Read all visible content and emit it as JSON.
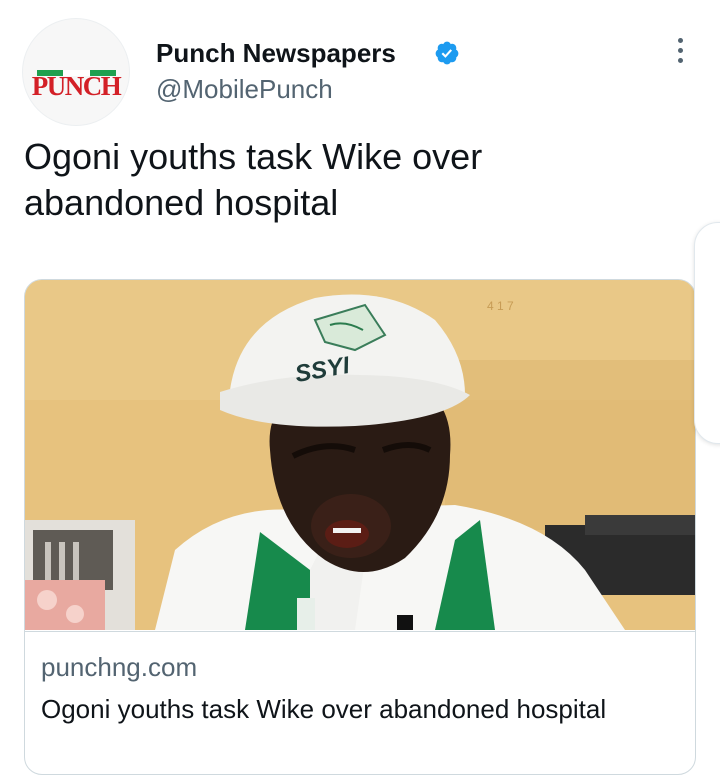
{
  "tweet": {
    "avatar": {
      "logo_text": "PUNCH",
      "stripe_colors": [
        "#1ea04f",
        "#ffffff",
        "#1ea04f"
      ],
      "logo_color": "#d32027"
    },
    "author": {
      "name": "Punch Newspapers",
      "handle": "@MobilePunch",
      "verified": true,
      "verified_color": "#1d9bf0"
    },
    "more_icon": "more-vertical-icon",
    "text": "Ogoni youths task Wike over abandoned hospital",
    "card": {
      "image_alt": "Man in white SSYI cap speaking, wearing green and white sash",
      "cap_text": "SSYI",
      "domain": "punchng.com",
      "title": "Ogoni youths task Wike over abandoned hospital"
    }
  }
}
